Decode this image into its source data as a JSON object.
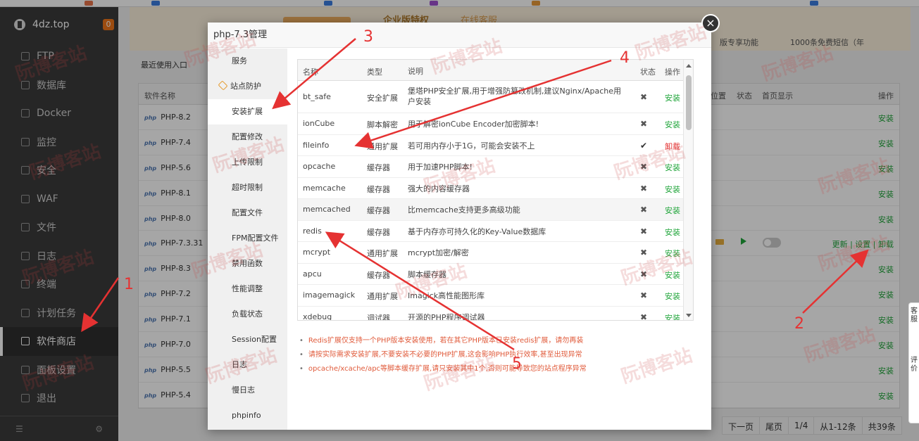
{
  "sidebar": {
    "site": "4dz.top",
    "badge": "0",
    "items": [
      {
        "label": "FTP",
        "icon": "globe-icon"
      },
      {
        "label": "数据库",
        "icon": "database-icon"
      },
      {
        "label": "Docker",
        "icon": "docker-icon"
      },
      {
        "label": "监控",
        "icon": "monitor-icon"
      },
      {
        "label": "安全",
        "icon": "shield-icon"
      },
      {
        "label": "WAF",
        "icon": "waf-shield-icon"
      },
      {
        "label": "文件",
        "icon": "folder-icon"
      },
      {
        "label": "日志",
        "icon": "log-icon"
      },
      {
        "label": "终端",
        "icon": "terminal-icon"
      },
      {
        "label": "计划任务",
        "icon": "calendar-icon"
      },
      {
        "label": "软件商店",
        "icon": "grid-icon",
        "active": true
      },
      {
        "label": "面板设置",
        "icon": "gear-icon"
      },
      {
        "label": "退出",
        "icon": "logout-icon"
      }
    ]
  },
  "banner": {
    "enterprise": "企业版特权",
    "service": "在线客服",
    "feature": "版专享功能",
    "sms": "1000条免费短信（年"
  },
  "main": {
    "recent": "最近使用入口",
    "headers": {
      "name": "软件名称",
      "position": "位置",
      "status": "状态",
      "home": "首页显示",
      "action": "操作"
    },
    "rows": [
      {
        "name": "PHP-8.2",
        "action": "安装"
      },
      {
        "name": "PHP-7.4",
        "action": "安装"
      },
      {
        "name": "PHP-5.6",
        "action": "安装"
      },
      {
        "name": "PHP-8.1",
        "action": "安装"
      },
      {
        "name": "PHP-8.0",
        "action": "安装"
      },
      {
        "name": "PHP-7.3.31",
        "action": "更新 | 设置 | 卸载",
        "installed": true
      },
      {
        "name": "PHP-8.3",
        "action": "安装"
      },
      {
        "name": "PHP-7.2",
        "action": "安装"
      },
      {
        "name": "PHP-7.1",
        "action": "安装"
      },
      {
        "name": "PHP-7.0",
        "action": "安装"
      },
      {
        "name": "PHP-5.5",
        "action": "安装"
      },
      {
        "name": "PHP-5.4",
        "action": "安装"
      }
    ],
    "php_tag": "php",
    "pager": [
      "下一页",
      "尾页",
      "1/4",
      "从1-12条",
      "共39条"
    ]
  },
  "modal": {
    "title": "php-7.3管理",
    "close": "×",
    "nav": [
      "服务",
      "站点防护",
      "安装扩展",
      "配置修改",
      "上传限制",
      "超时限制",
      "配置文件",
      "FPM配置文件",
      "禁用函数",
      "性能调整",
      "负载状态",
      "Session配置",
      "日志",
      "慢日志",
      "phpinfo"
    ],
    "active_nav": 2,
    "table_headers": {
      "name": "名称",
      "type": "类型",
      "desc": "说明",
      "status": "状态",
      "action": "操作"
    },
    "extensions": [
      {
        "name": "bt_safe",
        "type": "安全扩展",
        "desc": "堡塔PHP安全扩展,用于增强防篡改机制,建议Nginx/Apache用户安装",
        "status": "✖",
        "action": "安装"
      },
      {
        "name": "ionCube",
        "type": "脚本解密",
        "desc": "用于解密ionCube Encoder加密脚本!",
        "status": "✖",
        "action": "安装"
      },
      {
        "name": "fileinfo",
        "type": "通用扩展",
        "desc": "若可用内存小于1G，可能会安装不上",
        "status": "✔",
        "action": "卸载"
      },
      {
        "name": "opcache",
        "type": "缓存器",
        "desc": "用于加速PHP脚本!",
        "status": "✖",
        "action": "安装"
      },
      {
        "name": "memcache",
        "type": "缓存器",
        "desc": "强大的内容缓存器",
        "status": "✖",
        "action": "安装"
      },
      {
        "name": "memcached",
        "type": "缓存器",
        "desc": "比memcache支持更多高级功能",
        "status": "✖",
        "action": "安装"
      },
      {
        "name": "redis",
        "type": "缓存器",
        "desc": "基于内存亦可持久化的Key-Value数据库",
        "status": "✖",
        "action": "安装"
      },
      {
        "name": "mcrypt",
        "type": "通用扩展",
        "desc": "mcrypt加密/解密",
        "status": "✖",
        "action": "安装"
      },
      {
        "name": "apcu",
        "type": "缓存器",
        "desc": "脚本缓存器",
        "status": "✖",
        "action": "安装"
      },
      {
        "name": "imagemagick",
        "type": "通用扩展",
        "desc": "Imagick高性能图形库",
        "status": "✖",
        "action": "安装"
      },
      {
        "name": "xdebug",
        "type": "调试器",
        "desc": "开源的PHP程序调试器",
        "status": "✖",
        "action": "安装"
      }
    ],
    "notes": [
      "Redis扩展仅支持一个PHP版本安装使用，若在其它PHP版本已安装redis扩展，请勿再装",
      "请按实际需求安装扩展,不要安装不必要的PHP扩展,这会影响PHP执行效率,甚至出现异常",
      "opcache/xcache/apc等脚本缓存扩展,请只安装其中1个,否则可能导致您的站点程序异常"
    ]
  },
  "annotations": [
    "1",
    "2",
    "3",
    "4",
    "5"
  ],
  "float": {
    "a": "客服",
    "b": "评价"
  },
  "watermark": "阮博客站",
  "colors": {
    "accent": "#20a53a",
    "danger": "#e53232",
    "arrow": "#e53232",
    "sidebar": "#3b3b3b"
  }
}
